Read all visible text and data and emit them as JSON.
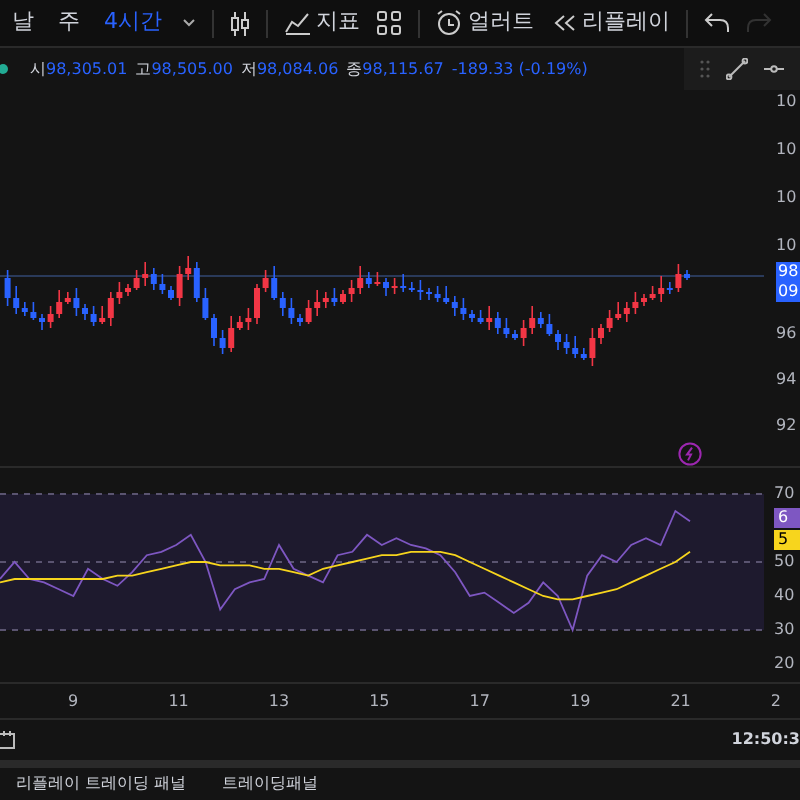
{
  "toolbar": {
    "intervals": [
      {
        "label": "날",
        "selected": false
      },
      {
        "label": "주",
        "selected": false
      },
      {
        "label": "4시간",
        "selected": true
      }
    ],
    "tools": [
      {
        "kind": "indicators",
        "label": "지표",
        "disabled": false
      },
      {
        "kind": "layouts",
        "disabled": false
      },
      {
        "kind": "alert",
        "label": "얼러트",
        "disabled": false
      },
      {
        "kind": "replay",
        "label": "리플레이",
        "disabled": false
      },
      {
        "kind": "undo",
        "disabled": false
      },
      {
        "kind": "redo",
        "disabled": true
      }
    ]
  },
  "legend": {
    "ohlc": [
      {
        "label": "시",
        "value": "98,305.01"
      },
      {
        "label": "고",
        "value": "98,505.00"
      },
      {
        "label": "저",
        "value": "98,084.06"
      },
      {
        "label": "종",
        "value": "98,115.67"
      }
    ],
    "change": "-189.33 (-0.19%)"
  },
  "price_axis": {
    "labels": [
      "10",
      "10",
      "10",
      "10",
      "96",
      "94",
      "92"
    ],
    "badge": [
      "98",
      "09"
    ]
  },
  "rsi": {
    "chart_data": {
      "type": "line",
      "grid": true,
      "ylim": [
        20,
        70
      ],
      "yticks": [
        {
          "value": 70,
          "label": "70"
        },
        {
          "value": 50,
          "label": "50"
        },
        {
          "value": 40,
          "label": "40"
        },
        {
          "value": 30,
          "label": "30"
        },
        {
          "value": 20,
          "label": "20"
        }
      ],
      "series": [
        {
          "color": "#7e57c2",
          "values": [
            45,
            50,
            45,
            44,
            42,
            40,
            48,
            45,
            43,
            47,
            52,
            53,
            55,
            58,
            50,
            36,
            42,
            44,
            45,
            55,
            48,
            46,
            44,
            52,
            53,
            58,
            55,
            57,
            55,
            54,
            52,
            47,
            40,
            41,
            38,
            35,
            38,
            44,
            40,
            30,
            46,
            52,
            50,
            55,
            57,
            55,
            65,
            62
          ]
        },
        {
          "color": "#f7d51d",
          "values": [
            44,
            45,
            45,
            45,
            45,
            45,
            45,
            45,
            46,
            46,
            47,
            48,
            49,
            50,
            50,
            49,
            49,
            49,
            48,
            48,
            47,
            46,
            48,
            49,
            50,
            51,
            52,
            52,
            53,
            53,
            53,
            52,
            50,
            48,
            46,
            44,
            42,
            40,
            39,
            39,
            40,
            41,
            42,
            44,
            46,
            48,
            50,
            53
          ]
        }
      ]
    },
    "badges": [
      {
        "text": "6",
        "color": "#7e57c2"
      },
      {
        "text": "5",
        "color": "#f7d51d"
      }
    ]
  },
  "date_axis": [
    "9",
    "11",
    "13",
    "15",
    "17",
    "19",
    "21",
    "2"
  ],
  "clock": "12:50:3",
  "bottom_tabs": [
    "리플레이 트레이딩 패널",
    "트레이딩패널"
  ]
}
